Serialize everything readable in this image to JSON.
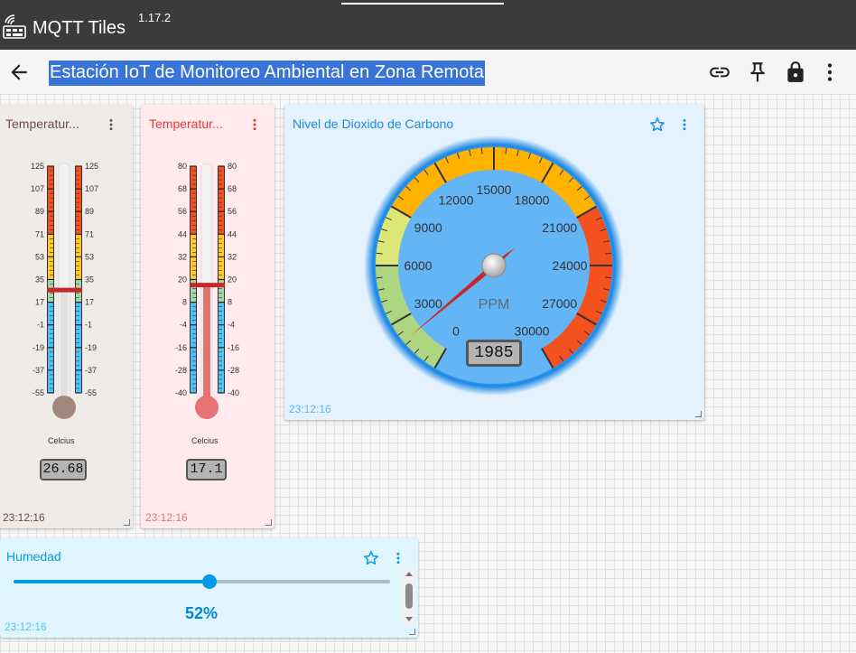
{
  "app": {
    "title": "MQTT Tiles",
    "version": "1.17.2",
    "icons": {
      "logo": "mqtt-tiles-logo-icon"
    }
  },
  "toolbar": {
    "page_title": "Estación IoT de Monitoreo Ambiental en Zona Remota",
    "icons": [
      "back-arrow-icon",
      "link-icon",
      "pin-icon",
      "lock-icon",
      "more-vert-icon"
    ]
  },
  "tiles": {
    "temp1": {
      "title": "Temperatur...",
      "unit": "Celcius",
      "value": "26.68",
      "value_num": 26.68,
      "timestamp": "23:12:16",
      "scale_min": -55,
      "scale_max": 125,
      "ticks": [
        "125",
        "107",
        "89",
        "71",
        "53",
        "35",
        "17",
        "-1",
        "-19",
        "-37",
        "-55"
      ],
      "fill": "#e0e0e0",
      "bulb": "#a1887f",
      "bands": [
        {
          "from": -55,
          "to": 17,
          "color": "#4fc3f7"
        },
        {
          "from": 17,
          "to": 35,
          "color": "#a5d6a7"
        },
        {
          "from": 35,
          "to": 71,
          "color": "#ffca28"
        },
        {
          "from": 71,
          "to": 125,
          "color": "#f4511e"
        }
      ]
    },
    "temp2": {
      "title": "Temperatur...",
      "unit": "Celcius",
      "value": "17.1",
      "value_num": 17.1,
      "timestamp": "23:12:16",
      "scale_min": -40,
      "scale_max": 80,
      "ticks": [
        "80",
        "68",
        "56",
        "44",
        "32",
        "20",
        "8",
        "-4",
        "-16",
        "-28",
        "-40"
      ],
      "fill": "#e57373",
      "bulb": "#e57373",
      "bands": [
        {
          "from": -40,
          "to": 8,
          "color": "#4fc3f7"
        },
        {
          "from": 8,
          "to": 20,
          "color": "#a5d6a7"
        },
        {
          "from": 20,
          "to": 44,
          "color": "#ffca28"
        },
        {
          "from": 44,
          "to": 80,
          "color": "#f4511e"
        }
      ]
    },
    "co2": {
      "title": "Nivel de Dioxido de Carbono",
      "unit": "PPM",
      "value": "1985",
      "value_num": 1985,
      "timestamp": "23:12:16",
      "min": 0,
      "max": 30000,
      "labels": [
        "0",
        "3000",
        "6000",
        "9000",
        "12000",
        "15000",
        "18000",
        "21000",
        "24000",
        "27000",
        "30000"
      ],
      "bands": [
        {
          "from": 0,
          "to": 6000,
          "color": "#aed581"
        },
        {
          "from": 6000,
          "to": 9000,
          "color": "#dce775"
        },
        {
          "from": 9000,
          "to": 21000,
          "color": "#ffb300"
        },
        {
          "from": 21000,
          "to": 30000,
          "color": "#f4511e"
        }
      ]
    },
    "humidity": {
      "title": "Humedad",
      "value": "52%",
      "value_frac": 0.52,
      "timestamp": "23:12:16"
    }
  },
  "colors": {
    "appbar": "#3b3b3b",
    "title_highlight": "#3874d8",
    "accent": "#039be5"
  }
}
